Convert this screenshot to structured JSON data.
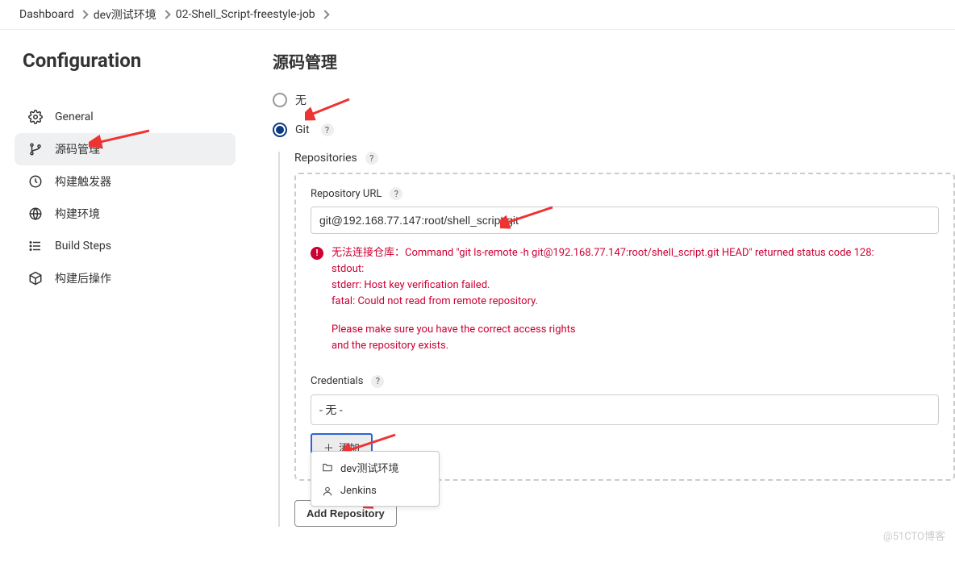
{
  "breadcrumb": {
    "item0": "Dashboard",
    "item1": "dev测试环境",
    "item2": "02-Shell_Script-freestyle-job"
  },
  "sidebar": {
    "title": "Configuration",
    "items": {
      "general": "General",
      "scm": "源码管理",
      "triggers": "构建触发器",
      "env": "构建环境",
      "steps": "Build Steps",
      "post": "构建后操作"
    }
  },
  "scm": {
    "title": "源码管理",
    "none_label": "无",
    "git_label": "Git",
    "repositories_label": "Repositories",
    "repo_url_label": "Repository URL",
    "repo_url_value": "git@192.168.77.147:root/shell_script.git",
    "error_line1": "无法连接仓库：Command \"git ls-remote -h git@192.168.77.147:root/shell_script.git HEAD\" returned status code 128:",
    "error_line2": "stdout:",
    "error_line3": "stderr: Host key verification failed.",
    "error_line4": "fatal: Could not read from remote repository.",
    "error_line5": "Please make sure you have the correct access rights",
    "error_line6": "and the repository exists.",
    "credentials_label": "Credentials",
    "credentials_value": "- 无 -",
    "add_button_label": "添加",
    "menu_item1": "dev测试环境",
    "menu_item2": "Jenkins",
    "add_repository_label": "Add Repository"
  },
  "watermark": "@51CTO博客"
}
